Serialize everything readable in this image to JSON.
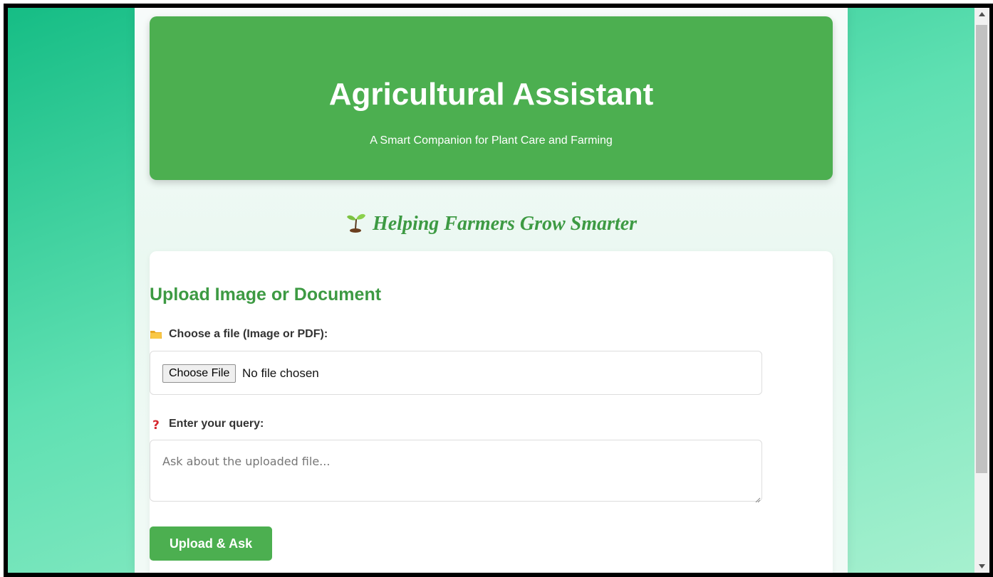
{
  "header": {
    "title": "Agricultural Assistant",
    "subtitle": "A Smart Companion for Plant Care and Farming"
  },
  "tagline": {
    "icon": "sprout-icon",
    "text": "Helping Farmers Grow Smarter"
  },
  "upload_card": {
    "title": "Upload Image or Document",
    "file_field": {
      "icon": "folder-icon",
      "label": "Choose a file (Image or PDF):",
      "button_label": "Choose File",
      "status": "No file chosen"
    },
    "query_field": {
      "icon": "question-icon",
      "label": "Enter your query:",
      "placeholder": "Ask about the uploaded file...",
      "value": ""
    },
    "submit_label": "Upload & Ask"
  },
  "colors": {
    "brand_green": "#4caf50",
    "heading_green": "#3d9a43",
    "bg_gradient_start": "#16bd85",
    "bg_gradient_end": "#a6f0cf"
  }
}
